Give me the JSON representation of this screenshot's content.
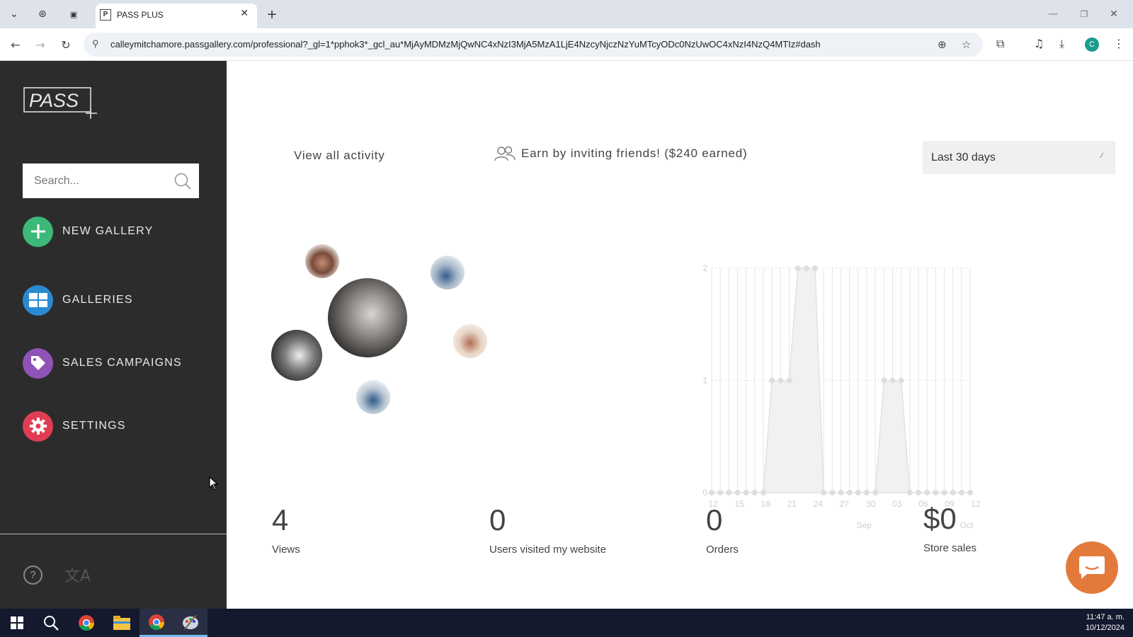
{
  "browser": {
    "tab_title": "PASS PLUS",
    "tab_favicon": "P",
    "url": "calleymitchamore.passgallery.com/professional?_gl=1*pphok3*_gcl_au*MjAyMDMzMjQwNC4xNzI3MjA5MzA1LjE4NzcyNjczNzYuMTcyODc0NzUwOC4xNzI4NzQ4MTIz#dash",
    "profile_initial": "C"
  },
  "sidebar": {
    "search_placeholder": "Search...",
    "items": [
      {
        "label": "NEW GALLERY",
        "icon": "plus-icon",
        "color": "#3cb878"
      },
      {
        "label": "GALLERIES",
        "icon": "grid-icon",
        "color": "#2a8ad1"
      },
      {
        "label": "SALES CAMPAIGNS",
        "icon": "tag-icon",
        "color": "#8f52b5"
      },
      {
        "label": "SETTINGS",
        "icon": "gear-icon",
        "color": "#e03d55"
      }
    ]
  },
  "main": {
    "view_all": "View all activity",
    "earn": "Earn by inviting friends! ($240 earned)",
    "range": "Last 30 days"
  },
  "chart_data": {
    "type": "area",
    "y_ticks": [
      "0",
      "1",
      "2"
    ],
    "x_ticks": [
      "12",
      "15",
      "18",
      "21",
      "24",
      "27",
      "30",
      "03",
      "06",
      "09",
      "12"
    ],
    "month_labels": [
      "Sep",
      "Oct"
    ],
    "ylim": [
      0,
      2
    ],
    "series": [
      {
        "values": [
          0,
          0,
          0,
          0,
          0,
          0,
          0,
          1,
          1,
          1,
          2,
          2,
          2,
          0,
          0,
          0,
          0,
          0,
          0,
          0,
          1,
          1,
          1,
          0,
          0,
          0,
          0,
          0,
          0,
          0,
          0
        ]
      }
    ],
    "grid": true
  },
  "stats": [
    {
      "value": "4",
      "caption": "Views"
    },
    {
      "value": "0",
      "caption": "Users visited my website"
    },
    {
      "value": "0",
      "caption": "Orders"
    },
    {
      "value": "$0",
      "caption": "Store sales"
    }
  ],
  "taskbar": {
    "time": "11:47 a. m.",
    "date": "10/12/2024"
  }
}
